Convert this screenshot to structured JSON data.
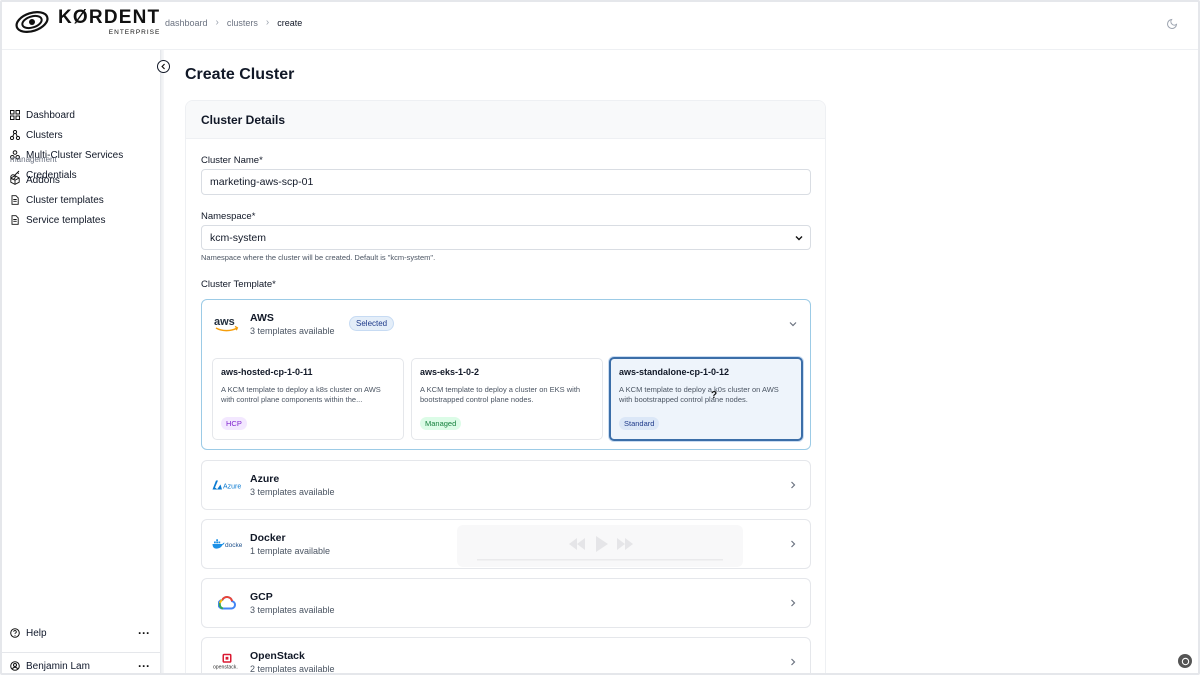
{
  "brand": {
    "name": "KØRDENT",
    "edition": "ENTERPRISE"
  },
  "breadcrumb": [
    "dashboard",
    "clusters",
    "create"
  ],
  "sidebar": {
    "primary": [
      {
        "label": "Dashboard",
        "icon": "grid-icon"
      },
      {
        "label": "Clusters",
        "icon": "network-icon"
      },
      {
        "label": "Multi-Cluster Services",
        "icon": "services-icon"
      },
      {
        "label": "Credentials",
        "icon": "key-icon"
      }
    ],
    "section_label": "management",
    "management": [
      {
        "label": "Addons",
        "icon": "box-icon"
      },
      {
        "label": "Cluster templates",
        "icon": "file-icon"
      },
      {
        "label": "Service templates",
        "icon": "file-icon"
      }
    ],
    "help_label": "Help",
    "user_name": "Benjamin Lam"
  },
  "page": {
    "title": "Create Cluster"
  },
  "card": {
    "title": "Cluster Details"
  },
  "form": {
    "name_label": "Cluster Name*",
    "name_value": "marketing-aws-scp-01",
    "namespace_label": "Namespace*",
    "namespace_value": "kcm-system",
    "namespace_help": "Namespace where the cluster will be created. Default is \"kcm-system\".",
    "template_label": "Cluster Template*"
  },
  "providers": [
    {
      "name": "AWS",
      "count": "3 templates available",
      "badge": "Selected",
      "expanded": true,
      "templates": [
        {
          "title": "aws-hosted-cp-1-0-11",
          "desc": "A KCM template to deploy a k8s cluster on AWS with control plane components within the...",
          "tag": "HCP",
          "tag_color": "#7e22ce",
          "tag_bg": "#f3e8ff"
        },
        {
          "title": "aws-eks-1-0-2",
          "desc": "A KCM template to deploy a cluster on EKS with bootstrapped control plane nodes.",
          "tag": "Managed",
          "tag_color": "#15803d",
          "tag_bg": "#dcfce7"
        },
        {
          "title": "aws-standalone-cp-1-0-12",
          "desc": "A KCM template to deploy a k0s cluster on AWS with bootstrapped control plane nodes.",
          "tag": "Standard",
          "tag_color": "#1e3a8a",
          "tag_bg": "#dbe7f7",
          "selected": true
        }
      ]
    },
    {
      "name": "Azure",
      "count": "3 templates available",
      "logo_text": "Azure"
    },
    {
      "name": "Docker",
      "count": "1 template available",
      "logo_text": "docker"
    },
    {
      "name": "GCP",
      "count": "3 templates available"
    },
    {
      "name": "OpenStack",
      "count": "2 templates available",
      "logo_text": "openstack."
    }
  ],
  "colors": {
    "accent": "#3b6ea8",
    "selected_bg": "#eef4fb",
    "border": "#e5e7eb"
  }
}
